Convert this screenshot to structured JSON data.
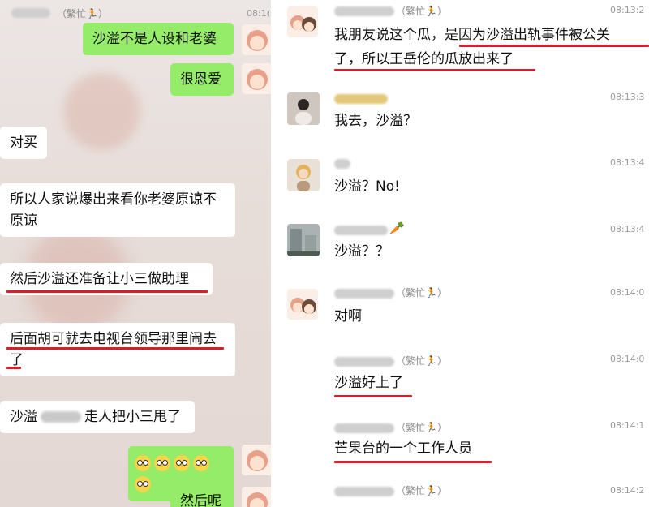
{
  "left_panel": {
    "header": {
      "status": "（繁忙",
      "time": "08:1("
    },
    "messages": [
      {
        "side": "right",
        "text": "沙溢不是人设和老婆"
      },
      {
        "side": "right",
        "text": "很恩爱"
      },
      {
        "side": "left",
        "text": "对买"
      },
      {
        "side": "left",
        "line1": "所以人家说爆出来看你老婆原谅不",
        "line2": "原谅"
      },
      {
        "side": "left",
        "text": "然后沙溢还准备让小三做助理"
      },
      {
        "side": "left",
        "line1": "后面胡可就去电视台领导那里闹去",
        "line2": "了"
      },
      {
        "side": "left",
        "text_a": "沙溢",
        "text_b": "走人把小三甩了"
      },
      {
        "side": "right",
        "emoji_count": 5,
        "emoji_name": "astonished-face-emoji"
      },
      {
        "side": "right",
        "text": "然后呢"
      }
    ]
  },
  "right_panel": {
    "messages": [
      {
        "status": "（繁忙",
        "time": "08:13:2",
        "line1": "我朋友说这个瓜，是因为沙溢出轨事件被公关",
        "line2": "了，所以王岳伦的瓜放出来了"
      },
      {
        "status": "",
        "time": "08:13:3",
        "text": "我去，沙溢？"
      },
      {
        "status": "",
        "time": "08:13:4",
        "text": "沙溢？No!"
      },
      {
        "status": "",
        "time": "08:13:4",
        "text": "沙溢？？"
      },
      {
        "status": "（繁忙",
        "time": "08:14:0",
        "text": "对啊"
      },
      {
        "status": "（繁忙",
        "time": "08:14:0",
        "text": "沙溢好上了"
      },
      {
        "status": "（繁忙",
        "time": "08:14:1",
        "text": "芒果台的一个工作人员"
      },
      {
        "status": "（繁忙",
        "time": "08:14:2"
      }
    ]
  },
  "colors": {
    "wechat_green": "#95ec69",
    "underline_red": "#d81e2a",
    "timestamp_gray": "#9a9a9a"
  }
}
